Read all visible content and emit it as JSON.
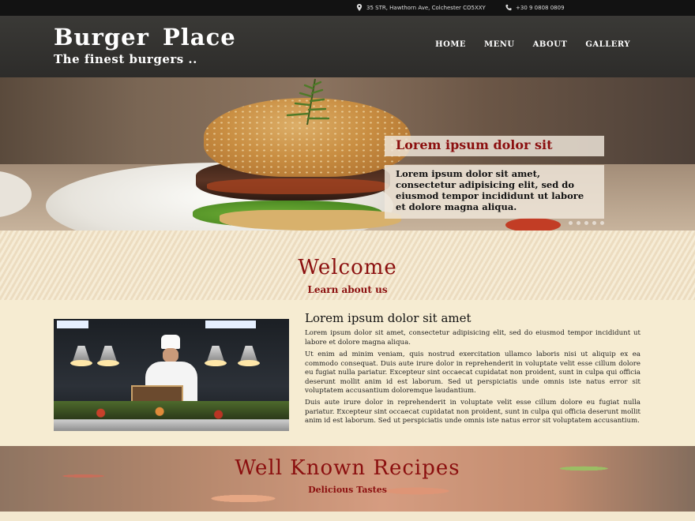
{
  "topbar": {
    "address": "35 STR, Hawthorn Ave, Colchester CO5XXY",
    "phone": "+30 9 0808 0809",
    "address_icon": "map-pin-icon",
    "phone_icon": "phone-icon"
  },
  "header": {
    "title": "Burger Place",
    "subtitle": "The finest burgers ..",
    "nav": [
      "HOME",
      "MENU",
      "ABOUT",
      "GALLERY"
    ]
  },
  "hero": {
    "caption_title": "Lorem ipsum dolor sit",
    "caption_body": "Lorem ipsum dolor sit amet, consectetur adipisicing elit, sed do eiusmod tempor incididunt ut labore et dolore magna aliqua."
  },
  "welcome": {
    "title": "Welcome",
    "subtitle": "Learn about us"
  },
  "article": {
    "title": "Lorem ipsum dolor sit amet",
    "paragraphs": [
      "Lorem ipsum dolor sit amet, consectetur adipisicing elit, sed do eiusmod tempor incididunt ut labore et dolore magna aliqua.",
      "Ut enim ad minim veniam, quis nostrud exercitation ullamco laboris nisi ut aliquip ex ea commodo consequat. Duis aute irure dolor in reprehenderit in voluptate velit esse cillum dolore eu fugiat nulla pariatur. Excepteur sint occaecat cupidatat non proident, sunt in culpa qui officia deserunt mollit anim id est laborum. Sed ut perspiciatis unde omnis iste natus error sit voluptatem accusantium doloremque laudantium.",
      "Duis aute irure dolor in reprehenderit in voluptate velit esse cillum dolore eu fugiat nulla pariatur. Excepteur sint occaecat cupidatat non proident, sunt in culpa qui officia deserunt mollit anim id est laborum. Sed ut perspiciatis unde omnis iste natus error sit voluptatem accusantium."
    ]
  },
  "recipes": {
    "title": "Well Known Recipes",
    "subtitle": "Delicious Tastes"
  },
  "colors": {
    "accent": "#8b0f0f",
    "header_bg": "#333230",
    "page_bg": "#f4ead0"
  }
}
